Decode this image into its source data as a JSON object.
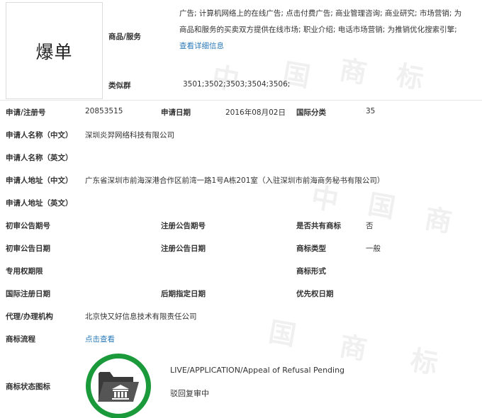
{
  "trademark": {
    "name": "爆单"
  },
  "goods": {
    "label": "商品/服务",
    "lines": [
      "广告; 计算机网络上的在线广告; 点击付费广告; 商业管理咨询; 商业研究; 市场营销; 为",
      "商品和服务的买卖双方提供在线市场; 职业介绍; 电话市场营销; 为推销优化搜索引擎;"
    ],
    "detail_link": "查看详细信息"
  },
  "similar_group": {
    "label": "类似群",
    "value": "3501;3502;3503;3504;3506;"
  },
  "fields": {
    "reg_no_label": "申请/注册号",
    "reg_no": "20853515",
    "apply_date_label": "申请日期",
    "apply_date": "2016年08月02日",
    "intl_class_label": "国际分类",
    "intl_class": "35",
    "applicant_cn_label": "申请人名称（中文）",
    "applicant_cn": "深圳炎羿网络科技有限公司",
    "applicant_en_label": "申请人名称（英文）",
    "address_cn_label": "申请人地址（中文）",
    "address_cn": "广东省深圳市前海深港合作区前湾一路1号A栋201室（入驻深圳市前海商务秘书有限公司）",
    "address_en_label": "申请人地址（英文）",
    "prelim_no_label": "初审公告期号",
    "reg_pub_no_label": "注册公告期号",
    "shared_label": "是否共有商标",
    "shared": "否",
    "prelim_date_label": "初审公告日期",
    "reg_pub_date_label": "注册公告日期",
    "type_label": "商标类型",
    "type": "一般",
    "exclusive_label": "专用权期限",
    "form_label": "商标形式",
    "intl_reg_date_label": "国际注册日期",
    "later_date_label": "后期指定日期",
    "priority_date_label": "优先权日期",
    "agent_label": "代理/办理机构",
    "agent": "北京快又好信息技术有限责任公司",
    "process_label": "商标流程",
    "process_link": "点击查看",
    "status_label": "商标状态图标",
    "status_en": "LIVE/APPLICATION/Appeal of Refusal Pending",
    "status_cn": "驳回复审中"
  },
  "colors": {
    "link": "#2a7ab8",
    "status_ring": "#1a9a3a"
  },
  "watermark_text": [
    "中",
    "国",
    "商",
    "标"
  ]
}
